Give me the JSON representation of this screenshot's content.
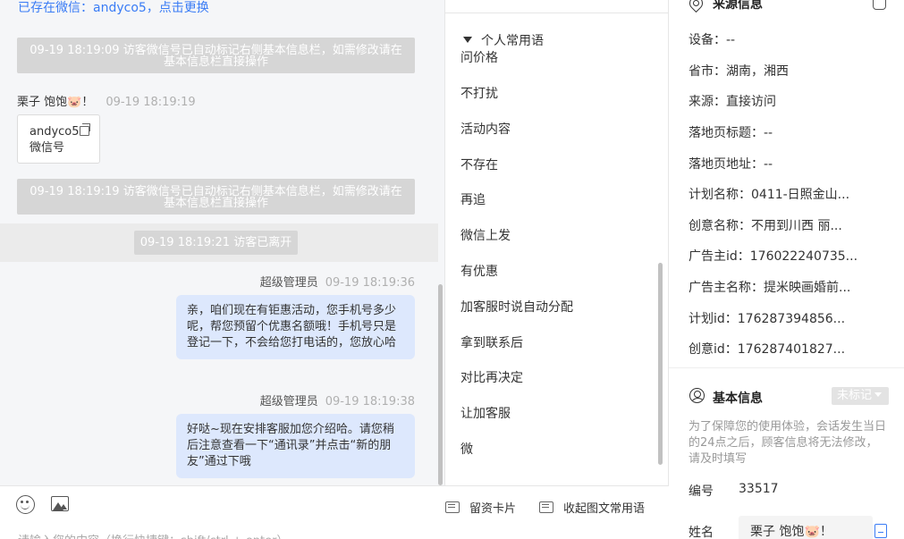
{
  "chat": {
    "top_tip": "已存在微信：andyco5，点击更换",
    "sys_msg_1": [
      "09-19 18:19:09 访客微信号已自动标记右侧基本信息栏，如需修改请在",
      "基本信息栏直接操作"
    ],
    "visitor": {
      "name": "栗子 饱饱🐷！",
      "time": "09-19 18:19:19"
    },
    "wechat_card": {
      "id": "andyco5",
      "label": "微信号"
    },
    "sys_msg_2": [
      "09-19 18:19:19 访客微信号已自动标记右侧基本信息栏，如需修改请在",
      "基本信息栏直接操作"
    ],
    "leave_msg": "09-19 18:19:21 访客已离开",
    "messages": [
      {
        "sender": "超级管理员",
        "time": "09-19 18:19:36",
        "text": "亲，咱们现在有钜惠活动，您手机号多少呢，帮您预留个优惠名额哦！手机号只是登记一下，不会给您打电话的，您放心哈"
      },
      {
        "sender": "超级管理员",
        "time": "09-19 18:19:38",
        "text": "好哒~现在安排客服加您介绍哈。请您稍后注意查看一下“通讯录”并点击“新的朋友”通过下哦"
      }
    ]
  },
  "phrases": {
    "header": "个人常用语",
    "items": [
      "问价格",
      "不打扰",
      "活动内容",
      "不存在",
      "再追",
      "微信上发",
      "有优惠",
      "加客服时说自动分配",
      "拿到联系后",
      "对比再决定",
      "让加客服",
      "微"
    ]
  },
  "input": {
    "leave_card": "留资卡片",
    "collapse_phrases": "收起图文常用语",
    "placeholder": "请输入您的内容（换行快捷键：shift/ctrl + enter）"
  },
  "info": {
    "source_title": "来源信息",
    "source_rows": [
      "设备：--",
      "省市：湖南，湘西",
      "来源：直接访问",
      "落地页标题：--",
      "落地页地址：--",
      "计划名称：0411-日照金山...",
      "创意名称：不用到川西 丽...",
      "广告主id：176022240735...",
      "广告主名称：提米映画婚前...",
      "计划id：176287394856...",
      "创意id：176287401827..."
    ],
    "basic_title": "基本信息",
    "tag": "未标记",
    "note": "为了保障您的使用体验，会话发生当日的24点之后，顾客信息将无法修改，请及时填写",
    "number_label": "编号",
    "number_value": "33517",
    "name_label": "姓名",
    "name_value": "栗子 饱饱🐷！"
  }
}
